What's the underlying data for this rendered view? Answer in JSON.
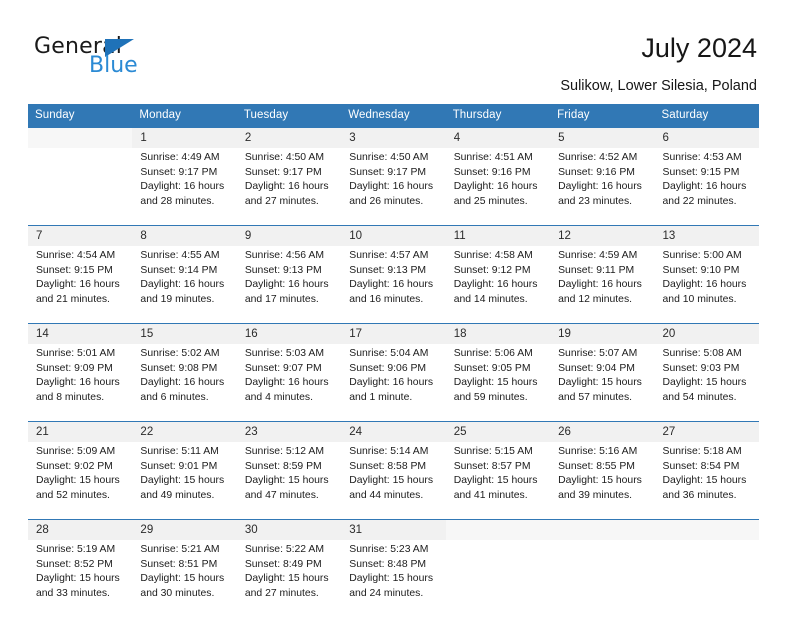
{
  "brand": {
    "name_dark": "General",
    "name_light": "Blue",
    "triangle_color": "#1f72b8",
    "light_color": "#2b8ad4"
  },
  "header": {
    "title": "July 2024",
    "subtitle": "Sulikow, Lower Silesia, Poland"
  },
  "calendar": {
    "header_color": "#3178b5",
    "daynum_bg": "#f1f1f1",
    "weekday_headers": [
      "Sunday",
      "Monday",
      "Tuesday",
      "Wednesday",
      "Thursday",
      "Friday",
      "Saturday"
    ],
    "weeks": [
      [
        {
          "day": "",
          "sunrise": "",
          "sunset": "",
          "daylight_1": "",
          "daylight_2": ""
        },
        {
          "day": "1",
          "sunrise": "Sunrise: 4:49 AM",
          "sunset": "Sunset: 9:17 PM",
          "daylight_1": "Daylight: 16 hours",
          "daylight_2": "and 28 minutes."
        },
        {
          "day": "2",
          "sunrise": "Sunrise: 4:50 AM",
          "sunset": "Sunset: 9:17 PM",
          "daylight_1": "Daylight: 16 hours",
          "daylight_2": "and 27 minutes."
        },
        {
          "day": "3",
          "sunrise": "Sunrise: 4:50 AM",
          "sunset": "Sunset: 9:17 PM",
          "daylight_1": "Daylight: 16 hours",
          "daylight_2": "and 26 minutes."
        },
        {
          "day": "4",
          "sunrise": "Sunrise: 4:51 AM",
          "sunset": "Sunset: 9:16 PM",
          "daylight_1": "Daylight: 16 hours",
          "daylight_2": "and 25 minutes."
        },
        {
          "day": "5",
          "sunrise": "Sunrise: 4:52 AM",
          "sunset": "Sunset: 9:16 PM",
          "daylight_1": "Daylight: 16 hours",
          "daylight_2": "and 23 minutes."
        },
        {
          "day": "6",
          "sunrise": "Sunrise: 4:53 AM",
          "sunset": "Sunset: 9:15 PM",
          "daylight_1": "Daylight: 16 hours",
          "daylight_2": "and 22 minutes."
        }
      ],
      [
        {
          "day": "7",
          "sunrise": "Sunrise: 4:54 AM",
          "sunset": "Sunset: 9:15 PM",
          "daylight_1": "Daylight: 16 hours",
          "daylight_2": "and 21 minutes."
        },
        {
          "day": "8",
          "sunrise": "Sunrise: 4:55 AM",
          "sunset": "Sunset: 9:14 PM",
          "daylight_1": "Daylight: 16 hours",
          "daylight_2": "and 19 minutes."
        },
        {
          "day": "9",
          "sunrise": "Sunrise: 4:56 AM",
          "sunset": "Sunset: 9:13 PM",
          "daylight_1": "Daylight: 16 hours",
          "daylight_2": "and 17 minutes."
        },
        {
          "day": "10",
          "sunrise": "Sunrise: 4:57 AM",
          "sunset": "Sunset: 9:13 PM",
          "daylight_1": "Daylight: 16 hours",
          "daylight_2": "and 16 minutes."
        },
        {
          "day": "11",
          "sunrise": "Sunrise: 4:58 AM",
          "sunset": "Sunset: 9:12 PM",
          "daylight_1": "Daylight: 16 hours",
          "daylight_2": "and 14 minutes."
        },
        {
          "day": "12",
          "sunrise": "Sunrise: 4:59 AM",
          "sunset": "Sunset: 9:11 PM",
          "daylight_1": "Daylight: 16 hours",
          "daylight_2": "and 12 minutes."
        },
        {
          "day": "13",
          "sunrise": "Sunrise: 5:00 AM",
          "sunset": "Sunset: 9:10 PM",
          "daylight_1": "Daylight: 16 hours",
          "daylight_2": "and 10 minutes."
        }
      ],
      [
        {
          "day": "14",
          "sunrise": "Sunrise: 5:01 AM",
          "sunset": "Sunset: 9:09 PM",
          "daylight_1": "Daylight: 16 hours",
          "daylight_2": "and 8 minutes."
        },
        {
          "day": "15",
          "sunrise": "Sunrise: 5:02 AM",
          "sunset": "Sunset: 9:08 PM",
          "daylight_1": "Daylight: 16 hours",
          "daylight_2": "and 6 minutes."
        },
        {
          "day": "16",
          "sunrise": "Sunrise: 5:03 AM",
          "sunset": "Sunset: 9:07 PM",
          "daylight_1": "Daylight: 16 hours",
          "daylight_2": "and 4 minutes."
        },
        {
          "day": "17",
          "sunrise": "Sunrise: 5:04 AM",
          "sunset": "Sunset: 9:06 PM",
          "daylight_1": "Daylight: 16 hours",
          "daylight_2": "and 1 minute."
        },
        {
          "day": "18",
          "sunrise": "Sunrise: 5:06 AM",
          "sunset": "Sunset: 9:05 PM",
          "daylight_1": "Daylight: 15 hours",
          "daylight_2": "and 59 minutes."
        },
        {
          "day": "19",
          "sunrise": "Sunrise: 5:07 AM",
          "sunset": "Sunset: 9:04 PM",
          "daylight_1": "Daylight: 15 hours",
          "daylight_2": "and 57 minutes."
        },
        {
          "day": "20",
          "sunrise": "Sunrise: 5:08 AM",
          "sunset": "Sunset: 9:03 PM",
          "daylight_1": "Daylight: 15 hours",
          "daylight_2": "and 54 minutes."
        }
      ],
      [
        {
          "day": "21",
          "sunrise": "Sunrise: 5:09 AM",
          "sunset": "Sunset: 9:02 PM",
          "daylight_1": "Daylight: 15 hours",
          "daylight_2": "and 52 minutes."
        },
        {
          "day": "22",
          "sunrise": "Sunrise: 5:11 AM",
          "sunset": "Sunset: 9:01 PM",
          "daylight_1": "Daylight: 15 hours",
          "daylight_2": "and 49 minutes."
        },
        {
          "day": "23",
          "sunrise": "Sunrise: 5:12 AM",
          "sunset": "Sunset: 8:59 PM",
          "daylight_1": "Daylight: 15 hours",
          "daylight_2": "and 47 minutes."
        },
        {
          "day": "24",
          "sunrise": "Sunrise: 5:14 AM",
          "sunset": "Sunset: 8:58 PM",
          "daylight_1": "Daylight: 15 hours",
          "daylight_2": "and 44 minutes."
        },
        {
          "day": "25",
          "sunrise": "Sunrise: 5:15 AM",
          "sunset": "Sunset: 8:57 PM",
          "daylight_1": "Daylight: 15 hours",
          "daylight_2": "and 41 minutes."
        },
        {
          "day": "26",
          "sunrise": "Sunrise: 5:16 AM",
          "sunset": "Sunset: 8:55 PM",
          "daylight_1": "Daylight: 15 hours",
          "daylight_2": "and 39 minutes."
        },
        {
          "day": "27",
          "sunrise": "Sunrise: 5:18 AM",
          "sunset": "Sunset: 8:54 PM",
          "daylight_1": "Daylight: 15 hours",
          "daylight_2": "and 36 minutes."
        }
      ],
      [
        {
          "day": "28",
          "sunrise": "Sunrise: 5:19 AM",
          "sunset": "Sunset: 8:52 PM",
          "daylight_1": "Daylight: 15 hours",
          "daylight_2": "and 33 minutes."
        },
        {
          "day": "29",
          "sunrise": "Sunrise: 5:21 AM",
          "sunset": "Sunset: 8:51 PM",
          "daylight_1": "Daylight: 15 hours",
          "daylight_2": "and 30 minutes."
        },
        {
          "day": "30",
          "sunrise": "Sunrise: 5:22 AM",
          "sunset": "Sunset: 8:49 PM",
          "daylight_1": "Daylight: 15 hours",
          "daylight_2": "and 27 minutes."
        },
        {
          "day": "31",
          "sunrise": "Sunrise: 5:23 AM",
          "sunset": "Sunset: 8:48 PM",
          "daylight_1": "Daylight: 15 hours",
          "daylight_2": "and 24 minutes."
        },
        {
          "day": "",
          "sunrise": "",
          "sunset": "",
          "daylight_1": "",
          "daylight_2": ""
        },
        {
          "day": "",
          "sunrise": "",
          "sunset": "",
          "daylight_1": "",
          "daylight_2": ""
        },
        {
          "day": "",
          "sunrise": "",
          "sunset": "",
          "daylight_1": "",
          "daylight_2": ""
        }
      ]
    ]
  }
}
